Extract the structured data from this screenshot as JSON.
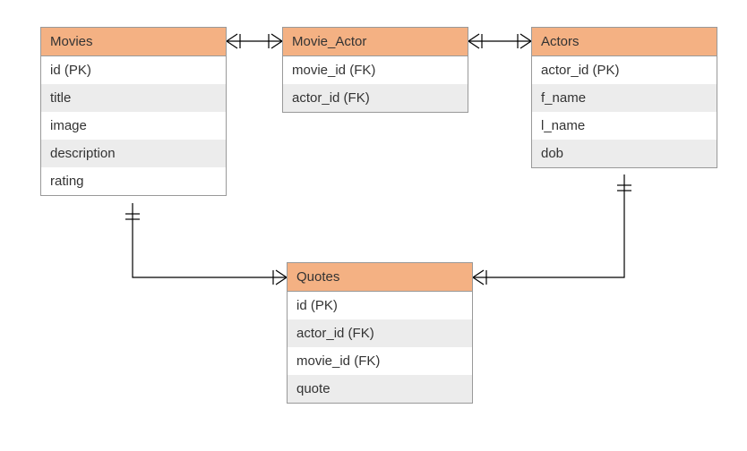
{
  "entities": {
    "movies": {
      "name": "Movies",
      "fields": [
        "id (PK)",
        "title",
        "image",
        "description",
        "rating"
      ]
    },
    "movie_actor": {
      "name": "Movie_Actor",
      "fields": [
        "movie_id (FK)",
        "actor_id (FK)"
      ]
    },
    "actors": {
      "name": "Actors",
      "fields": [
        "actor_id (PK)",
        "f_name",
        "l_name",
        "dob"
      ]
    },
    "quotes": {
      "name": "Quotes",
      "fields": [
        "id (PK)",
        "actor_id (FK)",
        "movie_id (FK)",
        "quote"
      ]
    }
  },
  "colors": {
    "header_bg": "#F4B183",
    "alt_row_bg": "#ECECEC",
    "border": "#999999"
  }
}
